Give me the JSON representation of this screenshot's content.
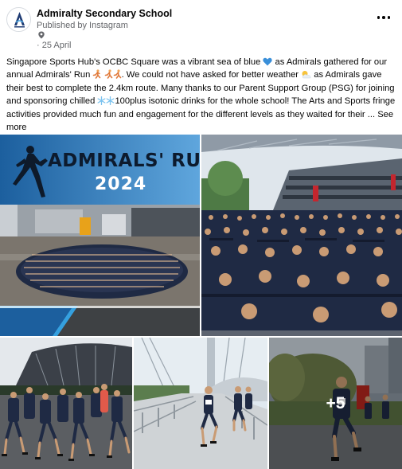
{
  "post": {
    "page_name": "Admiralty Secondary School",
    "published_by": "Published by Instagram",
    "date": "25 April",
    "date_separator": "·"
  },
  "caption": {
    "part1": "Singapore Sports Hub's OCBC Square was a vibrant sea of blue ",
    "part2": " as Admirals gathered for our annual Admirals' Run ",
    "part3": ". We could not have asked for better weather ",
    "part4": " as Admirals gave their best to complete the 2.4km route. Many thanks to our Parent Support Group (PSG) for joining and sponsoring chilled ",
    "part5": "100plus isotonic drinks for the whole school! The Arts and Sports fringe activities provided much fun and engagement for the different levels as they waited for their ... ",
    "see_more": "See more"
  },
  "photos": {
    "banner_title": "ADMIRALS' RUN",
    "banner_year": "2024",
    "more_count": "+5"
  },
  "icons": {
    "avatar": "school-crest-icon",
    "location": "location-pin-icon",
    "more": "more-options-icon",
    "heart": "blue-heart-emoji",
    "runner": "runner-emoji",
    "sun": "sun-behind-cloud-emoji",
    "snow": "snowflake-emoji"
  },
  "colors": {
    "banner_blue": "#2c6aa6",
    "uniform_navy": "#1f2a44",
    "text": "#050505",
    "muted": "#65676b"
  }
}
